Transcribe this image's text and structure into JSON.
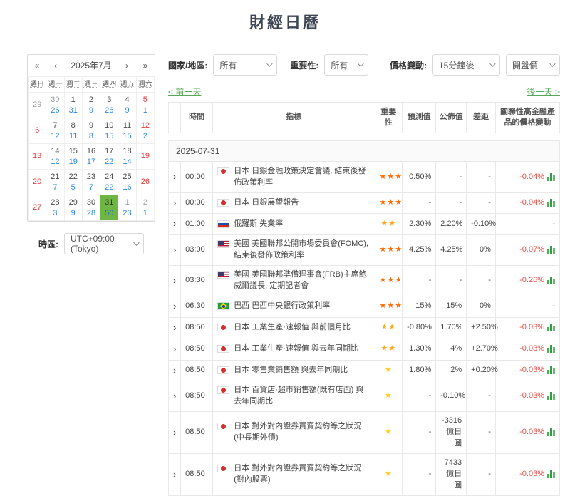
{
  "page": {
    "title": "財經日曆"
  },
  "calendar": {
    "nav": {
      "prev_year": "«",
      "prev_month": "‹",
      "title": "2025年7月",
      "next_month": "›",
      "next_year": "»"
    },
    "weekdays": [
      "週日",
      "週一",
      "週二",
      "週三",
      "週四",
      "週五",
      "週六"
    ],
    "weeks": [
      [
        {
          "d": "29",
          "t": "om"
        },
        {
          "d": "30",
          "c": "26",
          "t": "om"
        },
        {
          "d": "1",
          "c": "31"
        },
        {
          "d": "2",
          "c": "9"
        },
        {
          "d": "3",
          "c": "26"
        },
        {
          "d": "4",
          "c": "9"
        },
        {
          "d": "5",
          "c": "1",
          "t": "we"
        }
      ],
      [
        {
          "d": "6",
          "t": "we"
        },
        {
          "d": "7",
          "c": "12"
        },
        {
          "d": "8",
          "c": "11"
        },
        {
          "d": "9",
          "c": "8"
        },
        {
          "d": "10",
          "c": "15"
        },
        {
          "d": "11",
          "c": "15"
        },
        {
          "d": "12",
          "c": "2",
          "t": "we"
        }
      ],
      [
        {
          "d": "13",
          "t": "we"
        },
        {
          "d": "14",
          "c": "12"
        },
        {
          "d": "15",
          "c": "19"
        },
        {
          "d": "16",
          "c": "17"
        },
        {
          "d": "17",
          "c": "22"
        },
        {
          "d": "18",
          "c": "14"
        },
        {
          "d": "19",
          "t": "we"
        }
      ],
      [
        {
          "d": "20",
          "t": "we"
        },
        {
          "d": "21",
          "c": "7"
        },
        {
          "d": "22",
          "c": "5"
        },
        {
          "d": "23",
          "c": "7"
        },
        {
          "d": "24",
          "c": "22"
        },
        {
          "d": "25",
          "c": "16"
        },
        {
          "d": "26",
          "t": "we"
        }
      ],
      [
        {
          "d": "27",
          "t": "we"
        },
        {
          "d": "28",
          "c": "3"
        },
        {
          "d": "29",
          "c": "9"
        },
        {
          "d": "30",
          "c": "28"
        },
        {
          "d": "31",
          "c": "50",
          "t": "sel"
        },
        {
          "d": "1",
          "c": "23",
          "t": "om"
        },
        {
          "d": "2",
          "c": "1",
          "t": "om"
        }
      ]
    ],
    "timezone_label": "時區:",
    "timezone_value": "UTC+09:00 (Tokyo)"
  },
  "filters": {
    "region_label": "國家/地區:",
    "region_value": "所有",
    "importance_label": "重要性:",
    "importance_value": "所有",
    "price_label": "價格變動:",
    "price_window_value": "15分鐘後",
    "price_type_value": "開盤價"
  },
  "daynav": {
    "prev_day": "< 前一天",
    "next_day": "後一天 >"
  },
  "table": {
    "headers": [
      "",
      "時間",
      "指標",
      "重要性",
      "預測值",
      "公佈值",
      "差距",
      "關聯性高金融產品的價格變動"
    ],
    "date_group": "2025-07-31",
    "rows": [
      {
        "time": "00:00",
        "flag": "jp",
        "label": "日本 日銀金融政策決定會議, 結束後發佈政策利率",
        "stars": 3,
        "forecast": "0.50%",
        "actual": "-",
        "gap": "-",
        "gap_tone": "",
        "change": "-0.04%",
        "chart": true
      },
      {
        "time": "00:00",
        "flag": "jp",
        "label": "日本 日銀展望報告",
        "stars": 3,
        "forecast": "-",
        "actual": "-",
        "gap": "-",
        "gap_tone": "",
        "change": "-0.04%",
        "chart": true
      },
      {
        "time": "01:00",
        "flag": "ru",
        "label": "俄羅斯 失業率",
        "stars": 2,
        "forecast": "2.30%",
        "actual": "2.20%",
        "gap": "-0.10%",
        "gap_tone": "neg",
        "change": "-",
        "chart": false
      },
      {
        "time": "03:00",
        "flag": "us",
        "label": "美國 美國聯邦公開市場委員會(FOMC), 結束後發佈政策利率",
        "stars": 3,
        "forecast": "4.25%",
        "actual": "4.25%",
        "gap": "0%",
        "gap_tone": "",
        "change": "-0.07%",
        "chart": true
      },
      {
        "time": "03:30",
        "flag": "us",
        "label": "美國 美國聯邦準備理事會(FRB)主席鮑威爾議長, 定期記者會",
        "stars": 3,
        "forecast": "-",
        "actual": "-",
        "gap": "-",
        "gap_tone": "",
        "change": "-0.26%",
        "chart": true
      },
      {
        "time": "06:30",
        "flag": "br",
        "label": "巴西 巴西中央銀行政策利率",
        "stars": 3,
        "forecast": "15%",
        "actual": "15%",
        "gap": "0%",
        "gap_tone": "",
        "change": "-",
        "chart": false
      },
      {
        "time": "08:50",
        "flag": "jp",
        "label": "日本 工業生產·速報值 與前個月比",
        "stars": 2,
        "forecast": "-0.80%",
        "actual": "1.70%",
        "gap": "+2.50%",
        "gap_tone": "pos",
        "change": "-0.03%",
        "chart": true
      },
      {
        "time": "08:50",
        "flag": "jp",
        "label": "日本 工業生產·速報值 與去年同期比",
        "stars": 2,
        "forecast": "1.30%",
        "actual": "4%",
        "gap": "+2.70%",
        "gap_tone": "pos",
        "change": "-0.03%",
        "chart": true
      },
      {
        "time": "08:50",
        "flag": "jp",
        "label": "日本 零售業銷售額 與去年同期比",
        "stars": 1,
        "forecast": "1.80%",
        "actual": "2%",
        "gap": "+0.20%",
        "gap_tone": "pos",
        "change": "-0.03%",
        "chart": true
      },
      {
        "time": "08:50",
        "flag": "jp",
        "label": "日本 百貨店·超市銷售額(既有店面) 與去年同期比",
        "stars": 1,
        "forecast": "-",
        "actual": "-0.10%",
        "gap": "-",
        "gap_tone": "",
        "change": "-0.03%",
        "chart": true
      },
      {
        "time": "08:50",
        "flag": "jp",
        "label": "日本 對外對內證券買賣契約等之狀況(中長期外債)",
        "stars": 1,
        "forecast": "-",
        "actual": "-3316億日圓",
        "gap": "-",
        "gap_tone": "",
        "change": "-0.03%",
        "chart": true
      },
      {
        "time": "08:50",
        "flag": "jp",
        "label": "日本 對外對內證券買賣契約等之狀況(對內股票)",
        "stars": 1,
        "forecast": "-",
        "actual": "7433億日圓",
        "gap": "-",
        "gap_tone": "",
        "change": "-0.03%",
        "chart": true
      }
    ]
  },
  "colors": {
    "accent_green": "#55a855",
    "selected_day_bg": "#6fb544",
    "count_blue": "#2e86de",
    "weekend_red": "#e03c3c",
    "negative_red": "#e8524a",
    "positive_green": "#26a05a",
    "star_3": "#ff6a00",
    "star_2": "#ffa51f",
    "star_1": "#ffcd1f"
  }
}
